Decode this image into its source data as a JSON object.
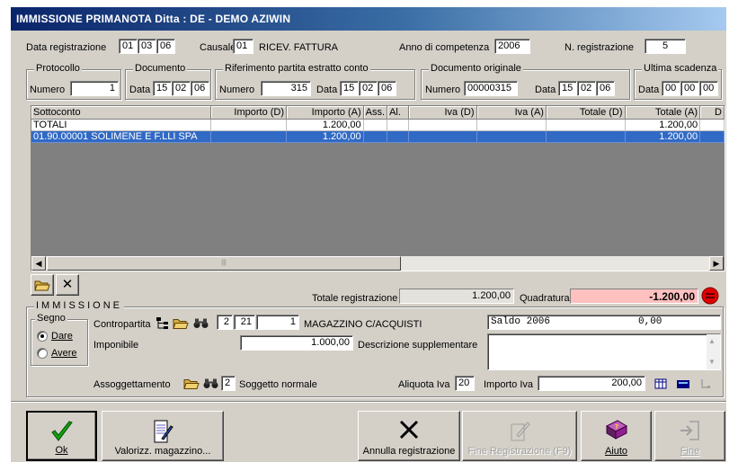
{
  "window": {
    "title": "IMMISSIONE PRIMANOTA  Ditta : DE - DEMO AZIWIN"
  },
  "header": {
    "data_registrazione_label": "Data registrazione",
    "data_registrazione": {
      "dd": "01",
      "mm": "03",
      "yy": "06"
    },
    "causale_label": "Causale",
    "causale_code": "01",
    "causale_desc": "RICEV. FATTURA",
    "anno_label": "Anno di competenza",
    "anno_value": "2006",
    "nreg_label": "N. registrazione",
    "nreg_value": "5"
  },
  "groups": {
    "protocollo": {
      "title": "Protocollo",
      "numero_label": "Numero",
      "numero": "1"
    },
    "documento": {
      "title": "Documento",
      "data_label": "Data",
      "dd": "15",
      "mm": "02",
      "yy": "06"
    },
    "riferimento": {
      "title": "Riferimento partita estratto conto",
      "numero_label": "Numero",
      "numero": "315",
      "data_label": "Data",
      "dd": "15",
      "mm": "02",
      "yy": "06"
    },
    "originale": {
      "title": "Documento originale",
      "numero_label": "Numero",
      "numero": "00000315",
      "data_label": "Data",
      "dd": "15",
      "mm": "02",
      "yy": "06"
    },
    "scadenza": {
      "title": "Ultima scadenza",
      "data_label": "Data",
      "dd": "00",
      "mm": "00",
      "yy": "00"
    }
  },
  "grid": {
    "columns": [
      "Sottoconto",
      "Importo (D)",
      "Importo (A)",
      "Ass.",
      "Al.",
      "Iva (D)",
      "Iva (A)",
      "Totale (D)",
      "Totale (A)",
      "D"
    ],
    "rows": [
      [
        "TOTALI",
        "",
        "1.200,00",
        "",
        "",
        "",
        "",
        "",
        "1.200,00",
        ""
      ],
      [
        "01.90.00001 SOLIMENE E F.LLI SPA",
        "",
        "1.200,00",
        "",
        "",
        "",
        "",
        "",
        "1.200,00",
        ""
      ]
    ],
    "selected_row": 1
  },
  "totals": {
    "totale_label": "Totale registrazione",
    "totale_value": "1.200,00",
    "quadratura_label": "Quadratura",
    "quadratura_value": "-1.200,00",
    "quadratura_color": "#ffc0c0"
  },
  "immissione": {
    "title": "IMMISSIONE",
    "segno_title": "Segno",
    "dare_label": "Dare",
    "avere_label": "Avere",
    "segno_selected": "Dare",
    "contropartita_label": "Contropartita",
    "contro_mastro": "2",
    "contro_conto": "21",
    "contro_sotto": "1",
    "contro_desc": "MAGAZZINO C/ACQUISTI",
    "saldo_label": "Saldo 2006",
    "saldo_value": "0,00",
    "imponibile_label": "Imponibile",
    "imponibile_value": "1.000,00",
    "descrizione_label": "Descrizione supplementare",
    "descrizione_value": "",
    "assoggettamento_label": "Assoggettamento",
    "assogg_code": "2",
    "assogg_desc": "Soggetto normale",
    "aliquota_label": "Aliquota Iva",
    "aliquota_value": "20",
    "importo_iva_label": "Importo Iva",
    "importo_iva_value": "200,00"
  },
  "buttons": {
    "ok": "Ok",
    "valorizz": "Valorizz. magazzino...",
    "annulla": "Annulla registrazione",
    "fine_reg": "Fine Registrazione (F9)",
    "aiuto": "Aiuto",
    "fine": "Fine"
  },
  "colors": {
    "selection": "#316ac5",
    "title_start": "#0a246a",
    "title_end": "#a6caf0",
    "stop_red": "#e00000"
  }
}
